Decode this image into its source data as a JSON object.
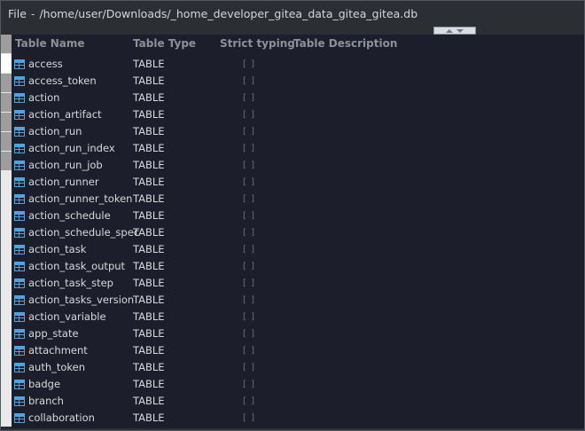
{
  "title_bar": {
    "menu": "File",
    "separator": "-",
    "path": "/home/user/Downloads/_home_developer_gitea_data_gitea_gitea.db"
  },
  "table": {
    "columns": [
      "Table Name",
      "Table Type",
      "Strict typing",
      "Table Description"
    ],
    "rows": [
      {
        "name": "access",
        "type": "TABLE",
        "strict": "[ ]",
        "description": ""
      },
      {
        "name": "access_token",
        "type": "TABLE",
        "strict": "[ ]",
        "description": ""
      },
      {
        "name": "action",
        "type": "TABLE",
        "strict": "[ ]",
        "description": ""
      },
      {
        "name": "action_artifact",
        "type": "TABLE",
        "strict": "[ ]",
        "description": ""
      },
      {
        "name": "action_run",
        "type": "TABLE",
        "strict": "[ ]",
        "description": ""
      },
      {
        "name": "action_run_index",
        "type": "TABLE",
        "strict": "[ ]",
        "description": ""
      },
      {
        "name": "action_run_job",
        "type": "TABLE",
        "strict": "[ ]",
        "description": ""
      },
      {
        "name": "action_runner",
        "type": "TABLE",
        "strict": "[ ]",
        "description": ""
      },
      {
        "name": "action_runner_token",
        "type": "TABLE",
        "strict": "[ ]",
        "description": ""
      },
      {
        "name": "action_schedule",
        "type": "TABLE",
        "strict": "[ ]",
        "description": ""
      },
      {
        "name": "action_schedule_spec",
        "type": "TABLE",
        "strict": "[ ]",
        "description": ""
      },
      {
        "name": "action_task",
        "type": "TABLE",
        "strict": "[ ]",
        "description": ""
      },
      {
        "name": "action_task_output",
        "type": "TABLE",
        "strict": "[ ]",
        "description": ""
      },
      {
        "name": "action_task_step",
        "type": "TABLE",
        "strict": "[ ]",
        "description": ""
      },
      {
        "name": "action_tasks_version",
        "type": "TABLE",
        "strict": "[ ]",
        "description": ""
      },
      {
        "name": "action_variable",
        "type": "TABLE",
        "strict": "[ ]",
        "description": ""
      },
      {
        "name": "app_state",
        "type": "TABLE",
        "strict": "[ ]",
        "description": ""
      },
      {
        "name": "attachment",
        "type": "TABLE",
        "strict": "[ ]",
        "description": ""
      },
      {
        "name": "auth_token",
        "type": "TABLE",
        "strict": "[ ]",
        "description": ""
      },
      {
        "name": "badge",
        "type": "TABLE",
        "strict": "[ ]",
        "description": ""
      },
      {
        "name": "branch",
        "type": "TABLE",
        "strict": "[ ]",
        "description": ""
      },
      {
        "name": "collaboration",
        "type": "TABLE",
        "strict": "[ ]",
        "description": ""
      }
    ]
  },
  "icons": {
    "row_icon": "table-icon",
    "splitter": [
      "arrow-up-icon",
      "arrow-down-icon"
    ]
  },
  "colors": {
    "panel_bg": "#1c1f2b",
    "window_bg": "#2b2e33",
    "table_icon": "#4fa3e0",
    "header_text": "#8d9097"
  }
}
